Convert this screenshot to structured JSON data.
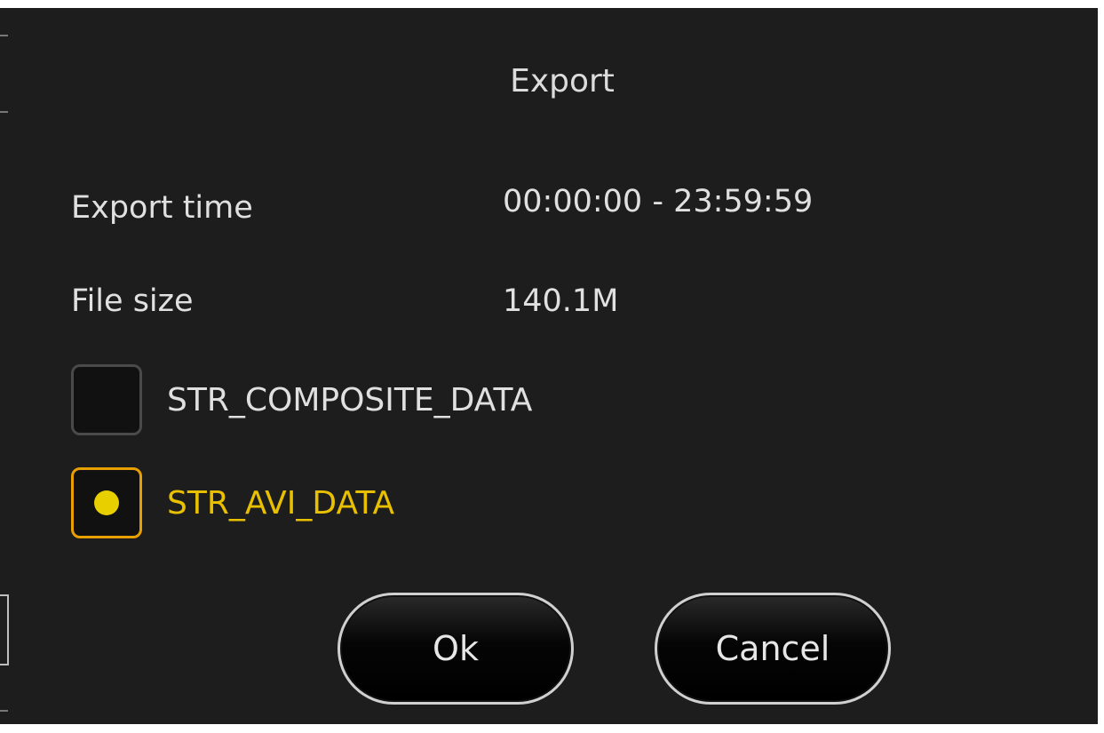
{
  "dialog": {
    "title": "Export"
  },
  "fields": {
    "export_time_label": "Export time",
    "export_time_value": "00:00:00 - 23:59:59",
    "file_size_label": "File size",
    "file_size_value": "140.1M"
  },
  "options": [
    {
      "label": "STR_COMPOSITE_DATA",
      "selected": false
    },
    {
      "label": "STR_AVI_DATA",
      "selected": true
    }
  ],
  "buttons": {
    "ok_label": "Ok",
    "cancel_label": "Cancel"
  },
  "colors": {
    "background": "#1d1d1d",
    "accent_border": "#e8a000",
    "accent_text": "#e8c000",
    "text": "#e0e0e0"
  }
}
